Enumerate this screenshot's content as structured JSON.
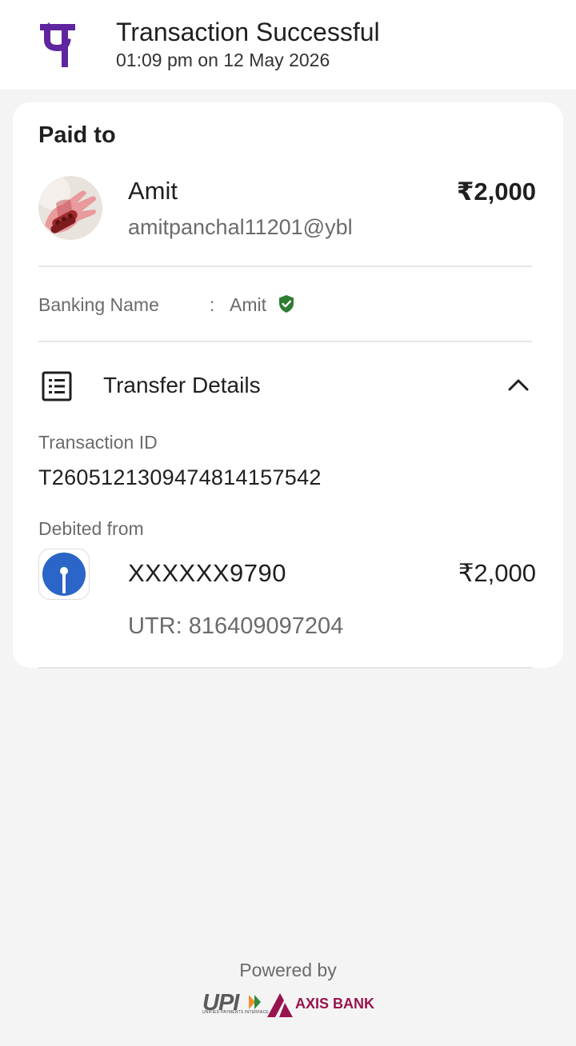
{
  "header": {
    "title": "Transaction Successful",
    "subtitle": "01:09 pm on 12 May 2026",
    "brand_color": "#5f259f"
  },
  "payment": {
    "paid_to_label": "Paid to",
    "payee_name": "Amit",
    "payee_upi": "amitpanchal11201@ybl",
    "amount": "₹2,000"
  },
  "banking": {
    "label": "Banking Name",
    "separator": ":",
    "value": "Amit",
    "verified_color": "#2e7d32"
  },
  "transfer": {
    "label": "Transfer Details",
    "icon": "list-icon",
    "expanded": true
  },
  "details": {
    "transaction_id_label": "Transaction ID",
    "transaction_id": "T2605121309474814157542",
    "debited_label": "Debited from",
    "account": "XXXXXX9790",
    "debited_amount": "₹2,000",
    "utr": "UTR: 816409097204",
    "bank_color": "#2a65c7"
  },
  "footer": {
    "powered_by": "Powered by",
    "upi_text": "UPI",
    "upi_subtext": "UNIFIED PAYMENTS INTERFACE",
    "bank_name": "AXIS BANK",
    "bank_color": "#97144d"
  }
}
